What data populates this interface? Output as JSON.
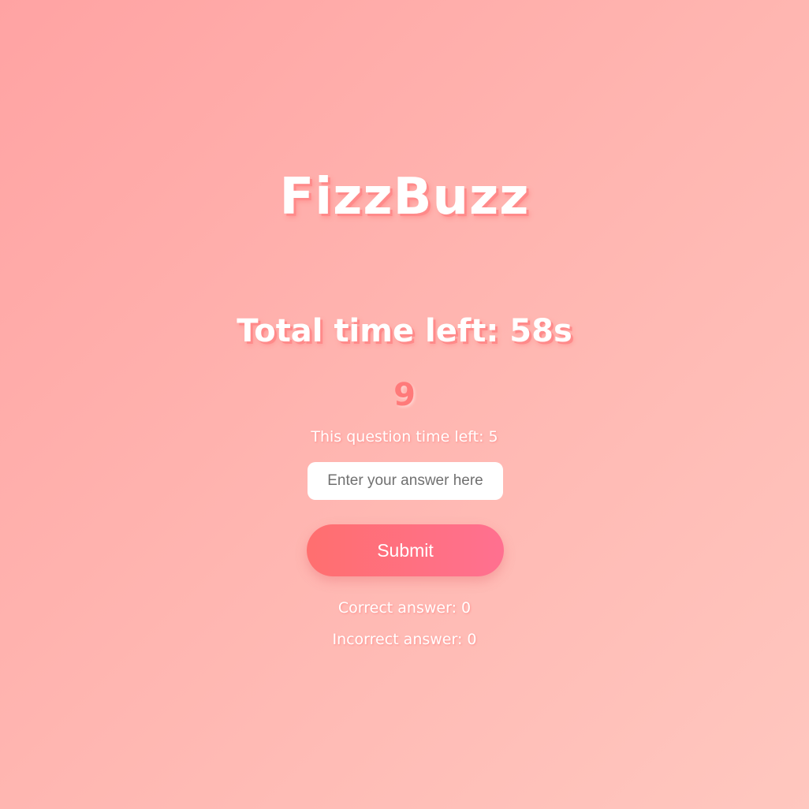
{
  "app": {
    "title": "FizzBuzz"
  },
  "game": {
    "total_time_text": "Total time left: 58s",
    "current_number": "9",
    "question_time_text": "This question time left: 5"
  },
  "answer_input": {
    "value": "",
    "placeholder": "Enter your answer here"
  },
  "submit": {
    "label": "Submit"
  },
  "stats": {
    "correct_text": "Correct answer: 0",
    "incorrect_text": "Incorrect answer: 0"
  },
  "colors": {
    "background_start": "#ffa3a3",
    "background_end": "#ffc7bf",
    "number_color": "#ff7a7a",
    "button_start": "#ff6f6f",
    "button_end": "#ff7090"
  }
}
